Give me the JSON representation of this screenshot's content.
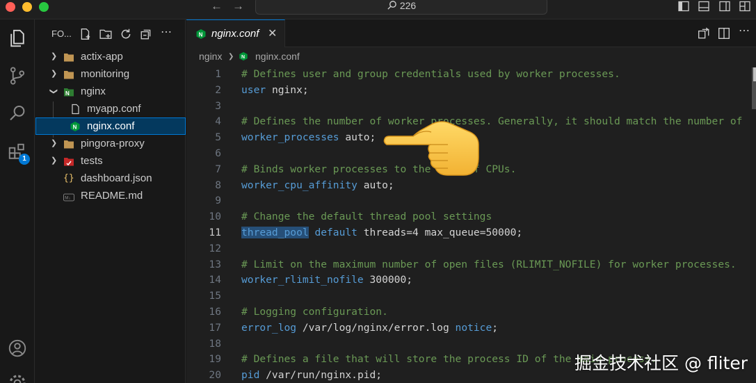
{
  "titlebar": {
    "search_text": "226",
    "back_icon": "arrow-left-icon",
    "forward_icon": "arrow-right-icon"
  },
  "activity_bar": {
    "items": [
      "explorer-icon",
      "source-control-icon",
      "search-icon",
      "extensions-icon"
    ],
    "extensions_badge": "1",
    "bottom": [
      "account-icon",
      "settings-icon"
    ]
  },
  "sidebar": {
    "title": "FO...",
    "items": [
      {
        "label": "actix-app",
        "kind": "folder",
        "expanded": false
      },
      {
        "label": "monitoring",
        "kind": "folder",
        "expanded": false
      },
      {
        "label": "nginx",
        "kind": "nginx-folder",
        "expanded": true
      },
      {
        "label": "myapp.conf",
        "kind": "file"
      },
      {
        "label": "nginx.conf",
        "kind": "nginx-file",
        "selected": true
      },
      {
        "label": "pingora-proxy",
        "kind": "folder",
        "expanded": false
      },
      {
        "label": "tests",
        "kind": "tests-folder",
        "expanded": false
      },
      {
        "label": "dashboard.json",
        "kind": "json-file"
      },
      {
        "label": "README.md",
        "kind": "markdown-file"
      }
    ]
  },
  "editor": {
    "tab_label": "nginx.conf",
    "breadcrumb": [
      "nginx",
      "nginx.conf"
    ],
    "active_line": 11,
    "lines": [
      {
        "n": "1",
        "parts": [
          [
            "cm",
            "# Defines user and group credentials used by worker processes."
          ]
        ]
      },
      {
        "n": "2",
        "parts": [
          [
            "kw",
            "user"
          ],
          [
            "tx",
            " nginx;"
          ]
        ]
      },
      {
        "n": "3",
        "parts": []
      },
      {
        "n": "4",
        "parts": [
          [
            "cm",
            "# Defines the number of worker processes. Generally, it should match the number of"
          ]
        ]
      },
      {
        "n": "5",
        "parts": [
          [
            "kw",
            "worker_processes"
          ],
          [
            "tx",
            " auto;"
          ]
        ]
      },
      {
        "n": "6",
        "parts": []
      },
      {
        "n": "7",
        "parts": [
          [
            "cm",
            "# Binds worker processes to the sets of CPUs."
          ]
        ]
      },
      {
        "n": "8",
        "parts": [
          [
            "kw",
            "worker_cpu_affinity"
          ],
          [
            "tx",
            " auto;"
          ]
        ]
      },
      {
        "n": "9",
        "parts": []
      },
      {
        "n": "10",
        "parts": [
          [
            "cm",
            "# Change the default thread pool settings"
          ]
        ]
      },
      {
        "n": "11",
        "parts": [
          [
            "kwhl",
            "thread_pool"
          ],
          [
            "tx",
            " "
          ],
          [
            "kw",
            "default"
          ],
          [
            "tx",
            " threads=4 max_queue=50000;"
          ]
        ]
      },
      {
        "n": "12",
        "parts": []
      },
      {
        "n": "13",
        "parts": [
          [
            "cm",
            "# Limit on the maximum number of open files (RLIMIT_NOFILE) for worker processes."
          ]
        ]
      },
      {
        "n": "14",
        "parts": [
          [
            "kw",
            "worker_rlimit_nofile"
          ],
          [
            "tx",
            " 300000;"
          ]
        ]
      },
      {
        "n": "15",
        "parts": []
      },
      {
        "n": "16",
        "parts": [
          [
            "cm",
            "# Logging configuration."
          ]
        ]
      },
      {
        "n": "17",
        "parts": [
          [
            "kw",
            "error_log"
          ],
          [
            "tx",
            " /var/log/nginx/error.log "
          ],
          [
            "kw",
            "notice"
          ],
          [
            "tx",
            ";"
          ]
        ]
      },
      {
        "n": "18",
        "parts": []
      },
      {
        "n": "19",
        "parts": [
          [
            "cm",
            "# Defines a file that will store the process ID of the main process."
          ]
        ]
      },
      {
        "n": "20",
        "parts": [
          [
            "kw",
            "pid"
          ],
          [
            "tx",
            " /var/run/nginx.pid;"
          ]
        ]
      }
    ]
  },
  "watermark": "掘金技术社区 @ fliter",
  "colors": {
    "accent": "#0078d4",
    "comment": "#6a9955",
    "keyword": "#569cd6",
    "selection": "#04395e"
  }
}
